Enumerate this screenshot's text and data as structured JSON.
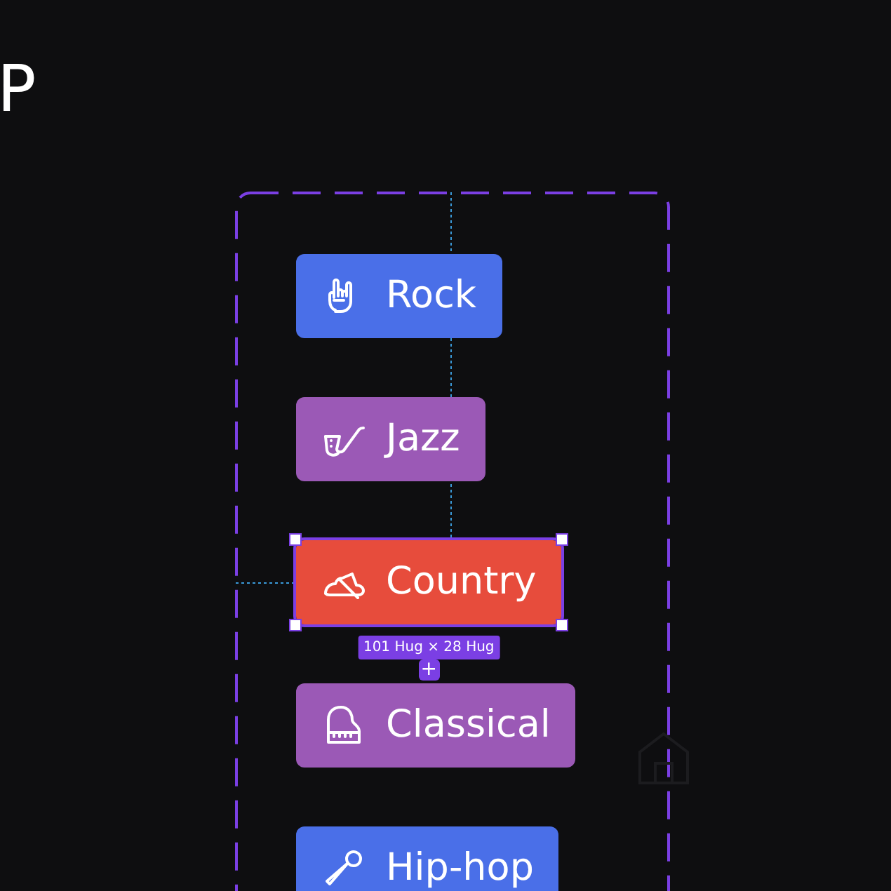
{
  "heading_fragment": "P",
  "genres": [
    {
      "label": "Rock",
      "color": "#4a6fe8",
      "selected": false
    },
    {
      "label": "Jazz",
      "color": "#9b59b6",
      "selected": false
    },
    {
      "label": "Country",
      "color": "#e74c3c",
      "selected": true
    },
    {
      "label": "Classical",
      "color": "#9b59b6",
      "selected": false
    },
    {
      "label": "Hip-hop",
      "color": "#4a6fe8",
      "selected": false
    }
  ],
  "selection": {
    "size_label": "101 Hug × 28 Hug",
    "add_button": "+"
  }
}
